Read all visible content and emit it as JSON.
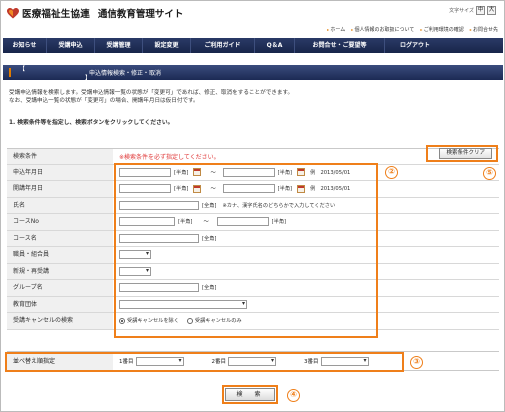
{
  "header": {
    "org": "医療福祉生協連",
    "system": "通信教育管理サイト",
    "fontsize_label": "文字サイズ",
    "fontsize_buttons": [
      "中",
      "大"
    ],
    "toplinks": [
      "ホーム",
      "個人情報のお取扱について",
      "ご利用環境の確認",
      "お問合せ先"
    ],
    "brand_color": "#c0392b"
  },
  "nav": {
    "items": [
      "お知らせ",
      "受講申込",
      "受講管理",
      "設定変更",
      "ご利用ガイド",
      "Q＆A",
      "お問合せ・ご要望等",
      "ログアウト"
    ]
  },
  "title": {
    "bracket": "【 　　　　　　　　　　　】",
    "text": "申込情報検索・修正・取消"
  },
  "intro": {
    "line1": "受講申込情報を検索します。受講申込情報一覧の状態が「変更可」であれば、修正、取消をすることができます。",
    "line2": "なお、受講申込一覧の状態が「変更可」の場合、開講年月日は仮日付です。",
    "step1": "1. 検索条件等を指定し、検索ボタンをクリックしてください。"
  },
  "form": {
    "cond_label": "検索条件",
    "cond_note": "※検索条件を必ず指定してください。",
    "clear_button": "検索条件クリア",
    "apply_date": {
      "label": "申込年月日",
      "unit1": "[半角]",
      "tilde": "～",
      "unit2": "[半角]",
      "example": "例　2013/05/01"
    },
    "open_date": {
      "label": "開講年月日",
      "unit1": "[半角]",
      "tilde": "～",
      "unit2": "[半角]",
      "example": "例　2013/05/01"
    },
    "name": {
      "label": "氏名",
      "unit": "[全角]",
      "hint": "※カナ、漢字氏名のどちらかで入力してください"
    },
    "course_no": {
      "label": "コースNo",
      "unit1": "[半角]",
      "tilde": "～",
      "unit2": "[半角]"
    },
    "course_name": {
      "label": "コース名",
      "unit": "[全角]"
    },
    "staff": {
      "label": "職員・組合員"
    },
    "new_retake": {
      "label": "新規・再受講"
    },
    "group_name": {
      "label": "グループ名",
      "unit": "[全角]"
    },
    "edu_org": {
      "label": "教育団体"
    },
    "cancel": {
      "label": "受講キャンセルの検索",
      "opt1": "受講キャンセルを除く",
      "opt2": "受講キャンセルのみ"
    },
    "sort": {
      "label": "並べ替え順指定",
      "first": "1番目",
      "second": "2番目",
      "third": "3番目"
    },
    "search_button": "検　索"
  },
  "annotations": {
    "color": "#ef7f1a",
    "m2": "②",
    "m3": "③",
    "m4": "④",
    "m5": "⑤"
  }
}
